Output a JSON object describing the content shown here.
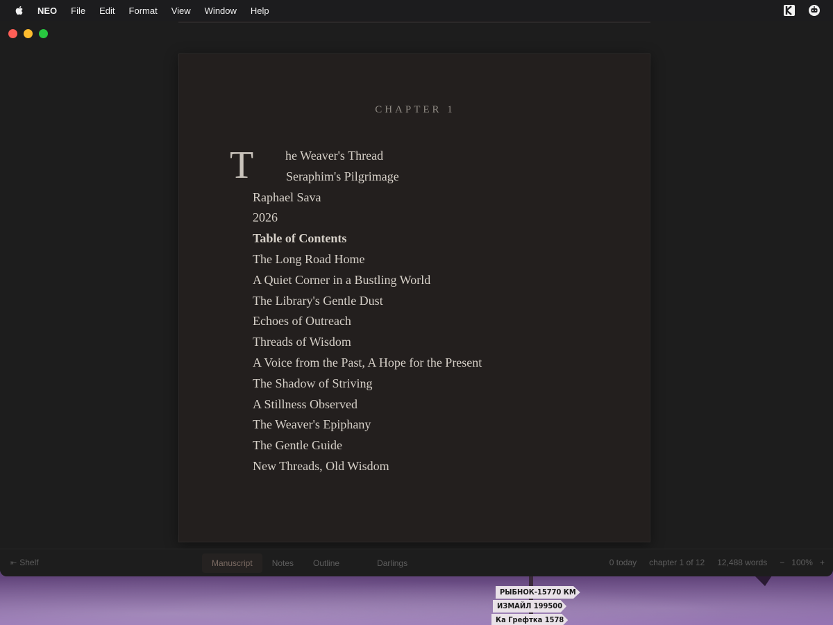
{
  "menubar": {
    "app_name": "NEO",
    "items": [
      "File",
      "Edit",
      "Format",
      "View",
      "Window",
      "Help"
    ]
  },
  "document": {
    "chapter_label": "CHAPTER 1",
    "drop_cap": "T",
    "first_line_rest": "he Weaver's Thread",
    "subtitle": "Seraphim's Pilgrimage",
    "author": "Raphael Sava",
    "year": "2026",
    "toc_heading": "Table of Contents",
    "toc": [
      "The Long Road Home",
      "A Quiet Corner in a Bustling World",
      "The Library's Gentle Dust",
      "Echoes of Outreach",
      "Threads of Wisdom",
      "A Voice from the Past, A Hope for the Present",
      "The Shadow of Striving",
      "A Stillness Observed",
      "The Weaver's Epiphany",
      "The Gentle Guide",
      "New Threads, Old Wisdom"
    ]
  },
  "statusbar": {
    "shelf_label": "Shelf",
    "tabs": [
      "Manuscript",
      "Notes",
      "Outline",
      "Darlings"
    ],
    "active_tab": "Manuscript",
    "today": "0 today",
    "chapter_position": "chapter 1 of 12",
    "word_count": "12,488 words",
    "zoom_minus": "−",
    "zoom_level": "100%",
    "zoom_plus": "+"
  },
  "wallpaper_signs": [
    "РЫБНОК-15770 КМ",
    "ИЗМАЙЛ 199500",
    "Ка Грефтка 1578"
  ]
}
